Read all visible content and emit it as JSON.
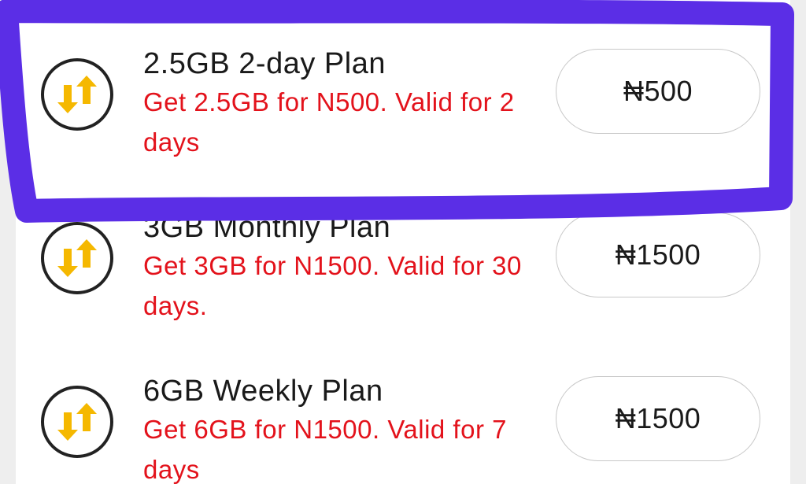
{
  "plans": [
    {
      "title": "2.5GB 2-day Plan",
      "description": "Get 2.5GB for N500. Valid for 2 days",
      "price": "₦500"
    },
    {
      "title": "3GB Monthly Plan",
      "description": "Get 3GB for N1500. Valid for 30 days.",
      "price": "₦1500"
    },
    {
      "title": "6GB Weekly Plan",
      "description": "Get 6GB for N1500. Valid for 7 days",
      "price": "₦1500"
    }
  ],
  "icons": {
    "plan_icon": "data-transfer-icon",
    "arrow_color": "#f5b800",
    "circle_color": "#222222"
  },
  "colors": {
    "description_text": "#e3121b",
    "highlight_stroke": "#5b2ee6"
  }
}
